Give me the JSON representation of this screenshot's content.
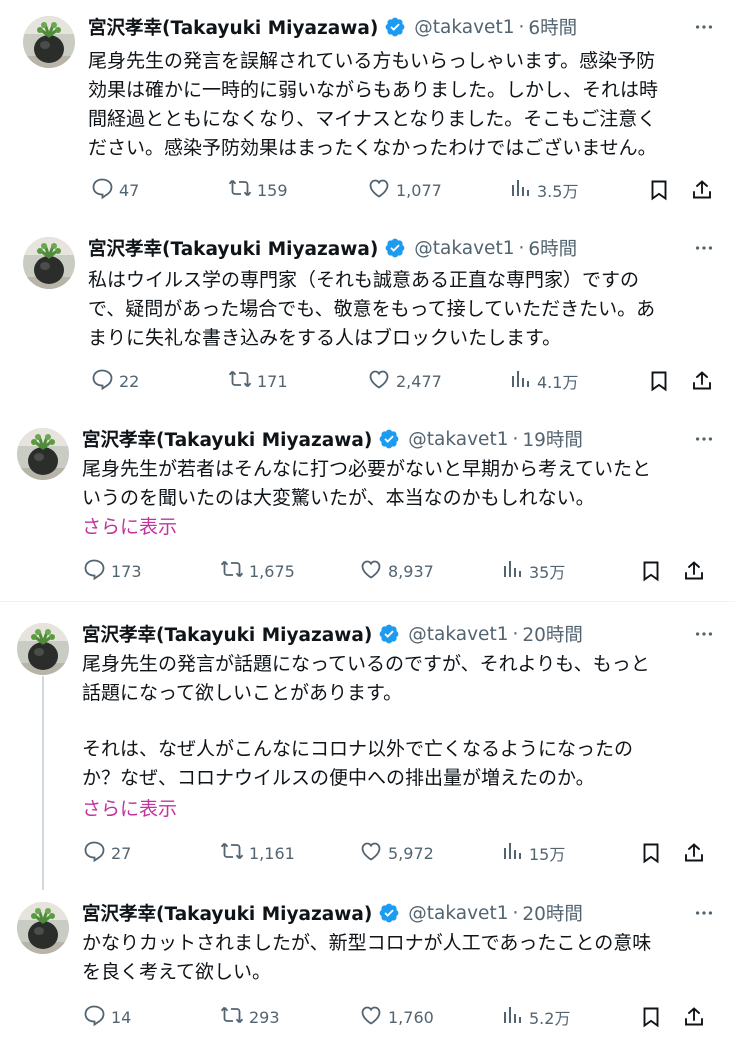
{
  "author": {
    "name": "宮沢孝幸(Takayuki Miyazawa)",
    "handle": "@takavet1",
    "separator": "·"
  },
  "colors": {
    "verified": "#1d9bf0",
    "show_more": "#c2349d",
    "secondary_text": "#536471",
    "thread_line": "#cfd9de"
  },
  "tweets": [
    {
      "time": "6時間",
      "lines": [
        "尾身先生の発言を誤解されている方もいらっしゃいます。感染予防",
        "効果は確かに一時的に弱いながらもありました。しかし、それは時",
        "間経過とともになくなり、マイナスとなりました。そこもご注意く",
        "ださい。感染予防効果はまったくなかったわけではございません。"
      ],
      "replies": "47",
      "reposts": "159",
      "likes": "1,077",
      "views": "3.5万"
    },
    {
      "time": "6時間",
      "lines": [
        "私はウイルス学の専門家（それも誠意ある正直な専門家）ですの",
        "で、疑問があった場合でも、敬意をもって接していただきたい。あ",
        "まりに失礼な書き込みをする人はブロックいたします。"
      ],
      "replies": "22",
      "reposts": "171",
      "likes": "2,477",
      "views": "4.1万"
    },
    {
      "time": "19時間",
      "lines": [
        "尾身先生が若者はそんなに打つ必要がないと早期から考えていたと",
        "いうのを聞いたのは大変驚いたが、本当なのかもしれない。"
      ],
      "show_more": "さらに表示",
      "replies": "173",
      "reposts": "1,675",
      "likes": "8,937",
      "views": "35万"
    },
    {
      "time": "20時間",
      "lines": [
        "尾身先生の発言が話題になっているのですが、それよりも、もっと",
        "話題になって欲しいことがあります。"
      ],
      "lines2": [
        "それは、なぜ人がこんなにコロナ以外で亡くなるようになったの",
        "か？なぜ、コロナウイルスの便中への排出量が増えたのか。"
      ],
      "show_more": "さらに表示",
      "replies": "27",
      "reposts": "1,161",
      "likes": "5,972",
      "views": "15万"
    },
    {
      "time": "20時間",
      "lines": [
        "かなりカットされましたが、新型コロナが人工であったことの意味",
        "を良く考えて欲しい。"
      ],
      "replies": "14",
      "reposts": "293",
      "likes": "1,760",
      "views": "5.2万"
    }
  ],
  "icons": {
    "reply": "reply-icon",
    "repost": "repost-icon",
    "like": "like-icon",
    "views": "views-icon",
    "bookmark": "bookmark-icon",
    "share": "share-icon",
    "more": "more-icon",
    "verified": "verified-badge-icon"
  }
}
